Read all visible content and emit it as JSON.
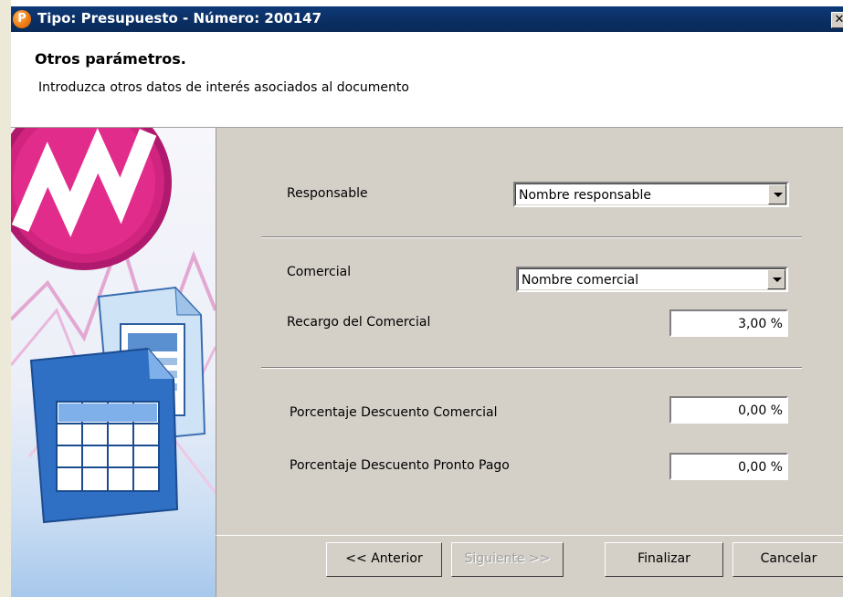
{
  "window": {
    "title": "Tipo: Presupuesto - Número: 200147",
    "app_icon_letter": "P",
    "close_symbol": "✕"
  },
  "header": {
    "title": "Otros parámetros.",
    "subtitle": "Introduzca otros datos de interés asociados al documento"
  },
  "form": {
    "responsable": {
      "label": "Responsable",
      "value": "Nombre responsable"
    },
    "comercial": {
      "label": "Comercial",
      "value": "Nombre comercial"
    },
    "recargo": {
      "label": "Recargo del Comercial",
      "value": "3,00 %"
    },
    "descuento_comercial": {
      "label": "Porcentaje Descuento Comercial",
      "value": "0,00 %"
    },
    "descuento_pronto_pago": {
      "label": "Porcentaje Descuento Pronto Pago",
      "value": "0,00 %"
    }
  },
  "buttons": {
    "back": "<< Anterior",
    "next": "Siguiente >>",
    "finish": "Finalizar",
    "cancel": "Cancelar"
  },
  "colors": {
    "titlebar": "#0b2f63",
    "panel": "#d4d0c8",
    "app_icon": "#f07c16"
  }
}
